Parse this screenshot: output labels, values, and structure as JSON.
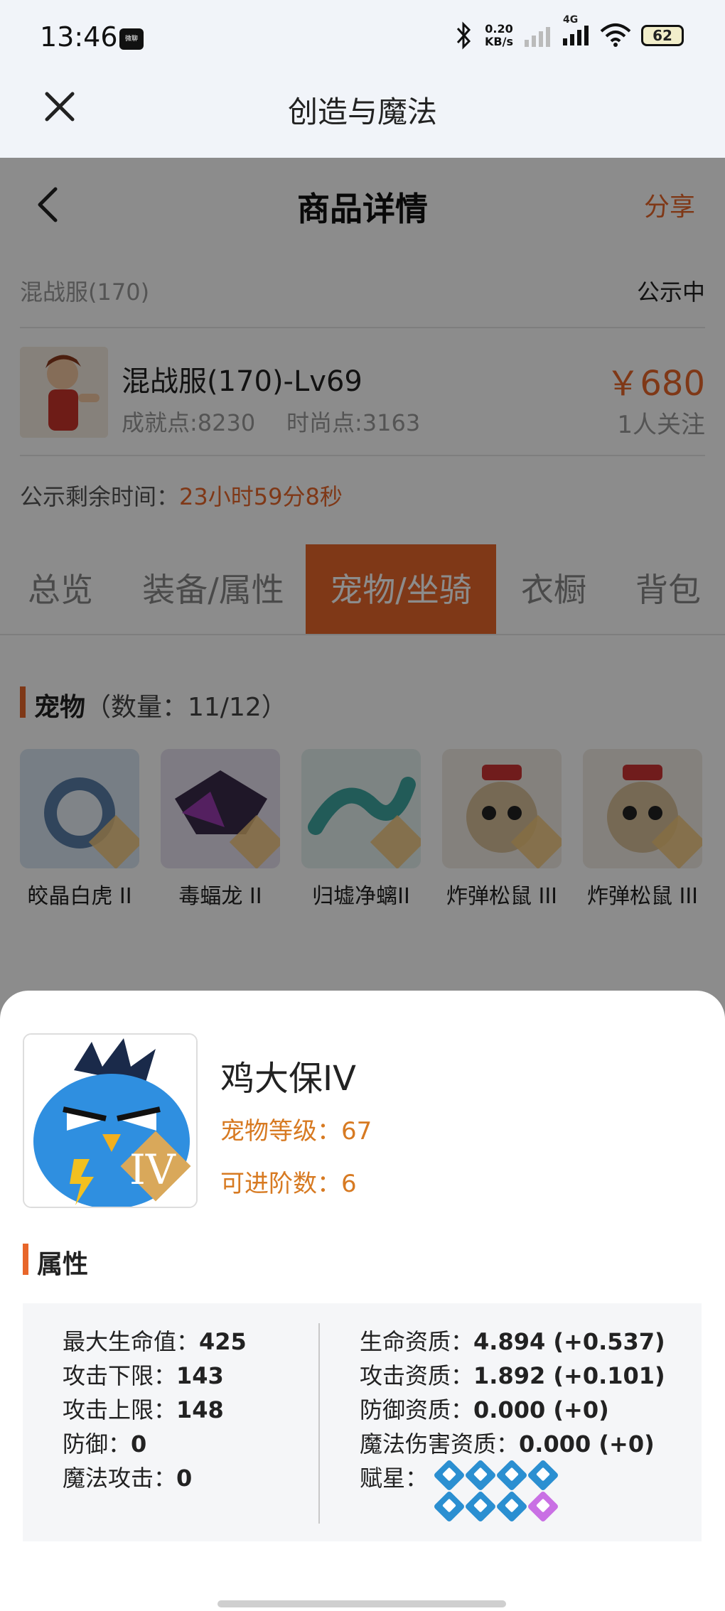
{
  "status_bar": {
    "time": "13:46",
    "app_icon": "微聊",
    "net_speed_value": "0.20",
    "net_speed_unit": "KB/s",
    "network": "4G",
    "battery": "62"
  },
  "webview": {
    "title": "创造与魔法"
  },
  "nav": {
    "title": "商品详情",
    "share_label": "分享"
  },
  "server": {
    "name": "混战服(170)",
    "status": "公示中"
  },
  "character": {
    "title": "混战服(170)-Lv69",
    "achievement": "成就点:8230",
    "fashion": "时尚点:3163",
    "price": "￥680",
    "followers": "1人关注"
  },
  "countdown": {
    "label": "公示剩余时间：",
    "value": "23小时59分8秒"
  },
  "tabs": [
    "总览",
    "装备/属性",
    "宠物/坐骑",
    "衣橱",
    "背包"
  ],
  "active_tab": "宠物/坐骑",
  "pets_section": {
    "title": "宠物",
    "count": "（数量：11/12）"
  },
  "pets": [
    {
      "name": "皎晶白虎 II",
      "icon": "white-tiger-icon"
    },
    {
      "name": "毒蝠龙 II",
      "icon": "bat-dragon-icon"
    },
    {
      "name": "归墟净螭II",
      "icon": "sea-dragon-icon"
    },
    {
      "name": "炸弹松鼠 III",
      "icon": "bomb-squirrel-icon"
    },
    {
      "name": "炸弹松鼠 III",
      "icon": "bomb-squirrel-icon"
    }
  ],
  "sheet": {
    "pet_name": "鸡大保IV",
    "level": "宠物等级：67",
    "advance": "可进阶数：6",
    "attr_title": "属性",
    "left_attrs": [
      {
        "label": "最大生命值：",
        "value": "425"
      },
      {
        "label": "攻击下限：",
        "value": "143"
      },
      {
        "label": "攻击上限：",
        "value": "148"
      },
      {
        "label": "防御：",
        "value": "0"
      },
      {
        "label": "魔法攻击：",
        "value": "0"
      }
    ],
    "right_attrs": [
      {
        "label": "生命资质：",
        "value": "4.894 (+0.537)"
      },
      {
        "label": "攻击资质：",
        "value": "1.892 (+0.101)"
      },
      {
        "label": "防御资质：",
        "value": "0.000 (+0)"
      },
      {
        "label": "魔法伤害资质：",
        "value": "0.000 (+0)"
      }
    ],
    "star_label": "赋星：",
    "stars": [
      "blue",
      "blue",
      "blue",
      "blue",
      "blue",
      "blue",
      "blue",
      "purple"
    ]
  },
  "colors": {
    "accent": "#e8662a",
    "highlight": "#d77a22",
    "star_blue": "#2b8fd1",
    "star_purple": "#c970e4"
  }
}
